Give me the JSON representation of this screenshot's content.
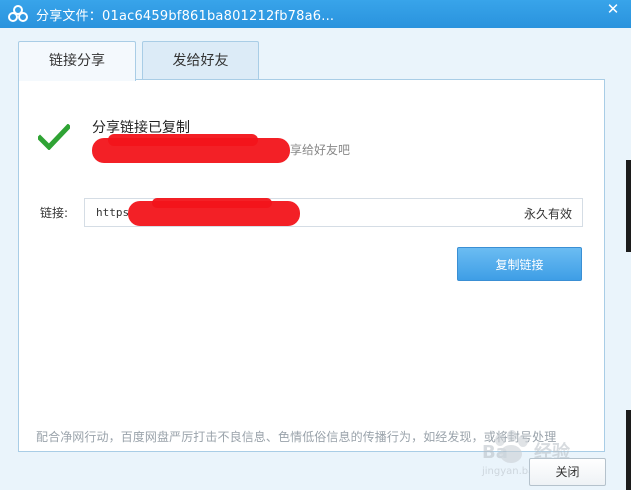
{
  "window": {
    "title": "分享文件：01ac6459bf861ba801212fb78a6...",
    "app_icon": "baidu-cloud-icon",
    "close_icon": "close-icon",
    "accent_color": "#2a93dd"
  },
  "tabs": [
    {
      "label": "链接分享",
      "active": true
    },
    {
      "label": "发给好友",
      "active": false
    }
  ],
  "status": {
    "icon": "checkmark-icon",
    "title": "分享链接已复制",
    "subtitle": "享给好友吧"
  },
  "link": {
    "label": "链接:",
    "value": "https",
    "validity": "永久有效"
  },
  "buttons": {
    "copy_label": "复制链接",
    "close_label": "关闭"
  },
  "notice": "配合净网行动，百度网盘严厉打击不良信息、色情低俗信息的传播行为，如经发现，或将封号处理",
  "watermark": {
    "text": "Bai经验",
    "url_text": "jingyan.baidu.com"
  }
}
